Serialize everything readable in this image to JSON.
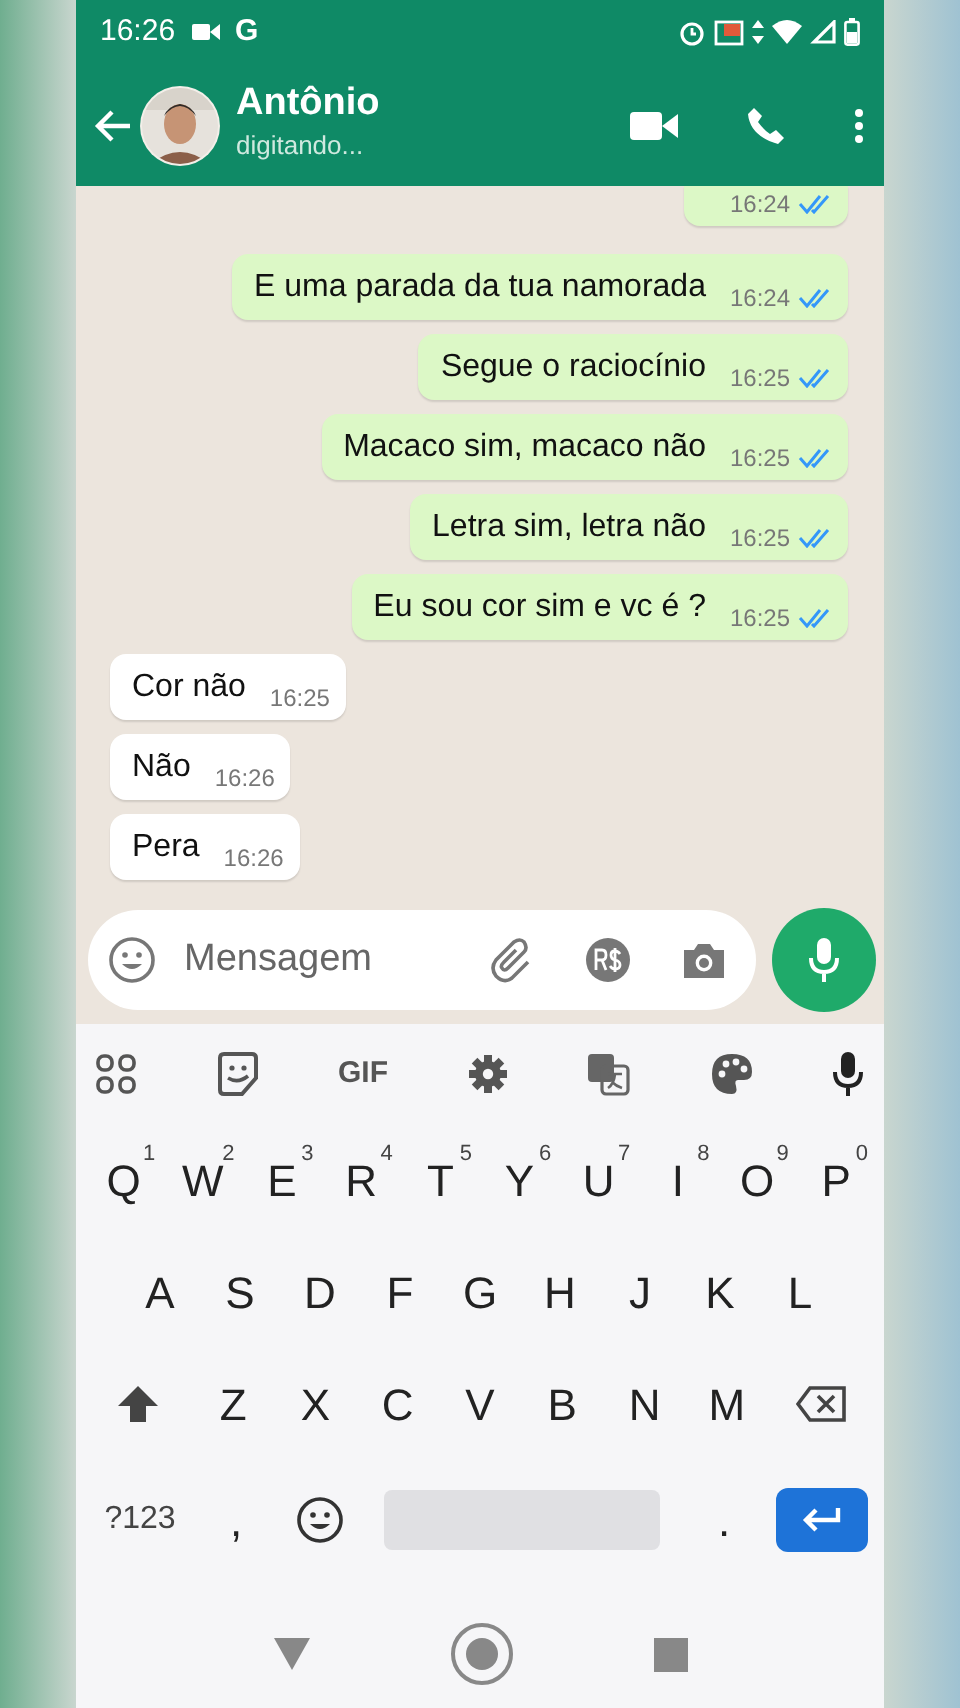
{
  "status_bar": {
    "time": "16:26",
    "carrier_letter": "G"
  },
  "header": {
    "name": "Antônio",
    "status": "digitando..."
  },
  "messages": [
    {
      "kind": "out",
      "time": "16:24",
      "read": true
    },
    {
      "kind": "out",
      "text": "E uma parada da tua namorada",
      "time": "16:24",
      "read": true
    },
    {
      "kind": "out",
      "text": "Segue o raciocínio",
      "time": "16:25",
      "read": true
    },
    {
      "kind": "out",
      "text": "Macaco sim, macaco não",
      "time": "16:25",
      "read": true
    },
    {
      "kind": "out",
      "text": "Letra sim, letra não",
      "time": "16:25",
      "read": true
    },
    {
      "kind": "out",
      "text": "Eu sou cor sim e vc é ?",
      "time": "16:25",
      "read": true
    },
    {
      "kind": "in",
      "text": "Cor não",
      "time": "16:25"
    },
    {
      "kind": "in",
      "text": "Não",
      "time": "16:26"
    },
    {
      "kind": "in",
      "text": "Pera",
      "time": "16:26"
    }
  ],
  "composer": {
    "placeholder": "Mensagem"
  },
  "keyboard": {
    "toolbar_gif": "GIF",
    "rows": [
      [
        {
          "label": "Q",
          "hint": "1"
        },
        {
          "label": "W",
          "hint": "2"
        },
        {
          "label": "E",
          "hint": "3"
        },
        {
          "label": "R",
          "hint": "4"
        },
        {
          "label": "T",
          "hint": "5"
        },
        {
          "label": "Y",
          "hint": "6"
        },
        {
          "label": "U",
          "hint": "7"
        },
        {
          "label": "I",
          "hint": "8"
        },
        {
          "label": "O",
          "hint": "9"
        },
        {
          "label": "P",
          "hint": "0"
        }
      ],
      [
        {
          "label": "A"
        },
        {
          "label": "S"
        },
        {
          "label": "D"
        },
        {
          "label": "F"
        },
        {
          "label": "G"
        },
        {
          "label": "H"
        },
        {
          "label": "J"
        },
        {
          "label": "K"
        },
        {
          "label": "L"
        }
      ],
      [
        {
          "label": "Z"
        },
        {
          "label": "X"
        },
        {
          "label": "C"
        },
        {
          "label": "V"
        },
        {
          "label": "B"
        },
        {
          "label": "N"
        },
        {
          "label": "M"
        }
      ]
    ],
    "symbols_key": "?123",
    "comma_key": ",",
    "period_key": "."
  }
}
